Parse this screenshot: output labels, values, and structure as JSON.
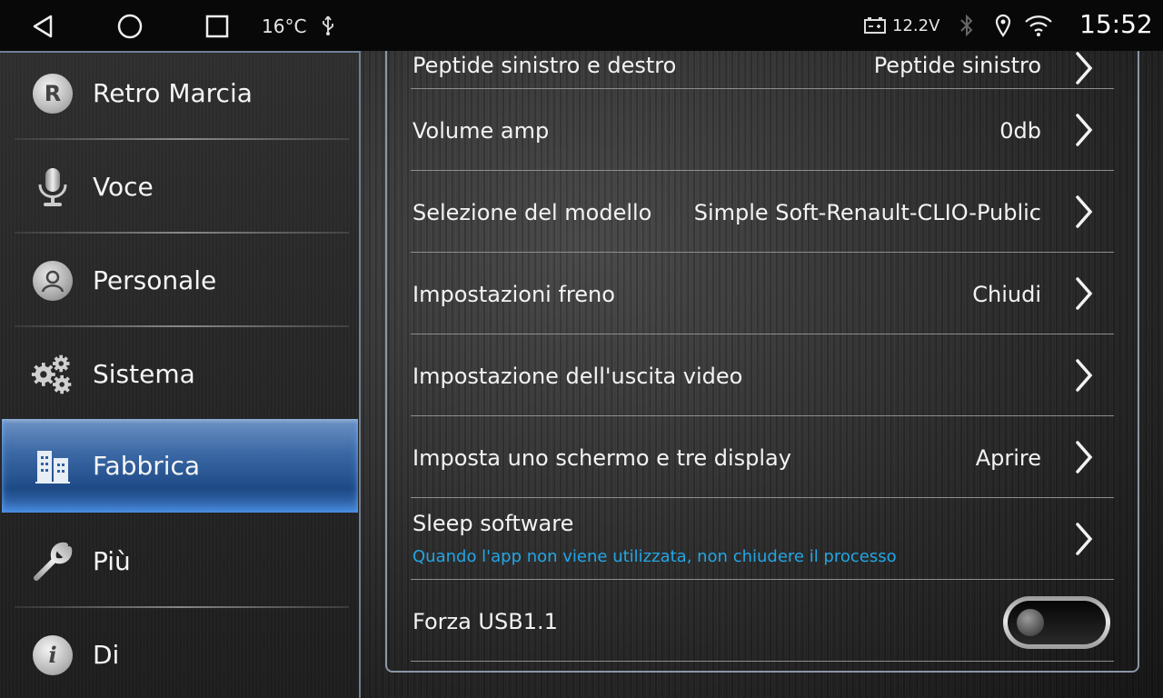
{
  "statusbar": {
    "temperature": "16°C",
    "voltage": "12.2V",
    "clock": "15:52",
    "icons": [
      "back-icon",
      "home-icon",
      "recents-icon",
      "usb-icon",
      "battery-icon",
      "bluetooth-icon",
      "location-icon",
      "wifi-icon"
    ]
  },
  "sidebar": {
    "items": [
      {
        "label": "Retro Marcia",
        "icon": "reverse-r-icon",
        "badge": "R"
      },
      {
        "label": "Voce",
        "icon": "microphone-icon"
      },
      {
        "label": "Personale",
        "icon": "person-icon"
      },
      {
        "label": "Sistema",
        "icon": "gears-icon"
      },
      {
        "label": "Fabbrica",
        "icon": "factory-icon",
        "active": true
      },
      {
        "label": "Più",
        "icon": "wrench-icon"
      },
      {
        "label": "Di",
        "icon": "info-icon",
        "badge": "i"
      }
    ]
  },
  "settings": {
    "rows": [
      {
        "label": "Peptide sinistro e destro",
        "value": "Peptide sinistro"
      },
      {
        "label": "Volume amp",
        "value": "0db"
      },
      {
        "label": "Selezione del modello",
        "value": "Simple Soft-Renault-CLIO-Public"
      },
      {
        "label": "Impostazioni freno",
        "value": "Chiudi"
      },
      {
        "label": "Impostazione dell'uscita video",
        "value": ""
      },
      {
        "label": "Imposta uno schermo e tre display",
        "value": "Aprire"
      },
      {
        "label": "Sleep software",
        "value": "",
        "subtitle": "Quando l'app non viene utilizzata, non chiudere il processo"
      },
      {
        "label": "Forza USB1.1",
        "toggle": "off"
      }
    ]
  },
  "colors": {
    "accent_blue": "#2f5f9e",
    "subtitle_blue": "#23a6e6"
  }
}
